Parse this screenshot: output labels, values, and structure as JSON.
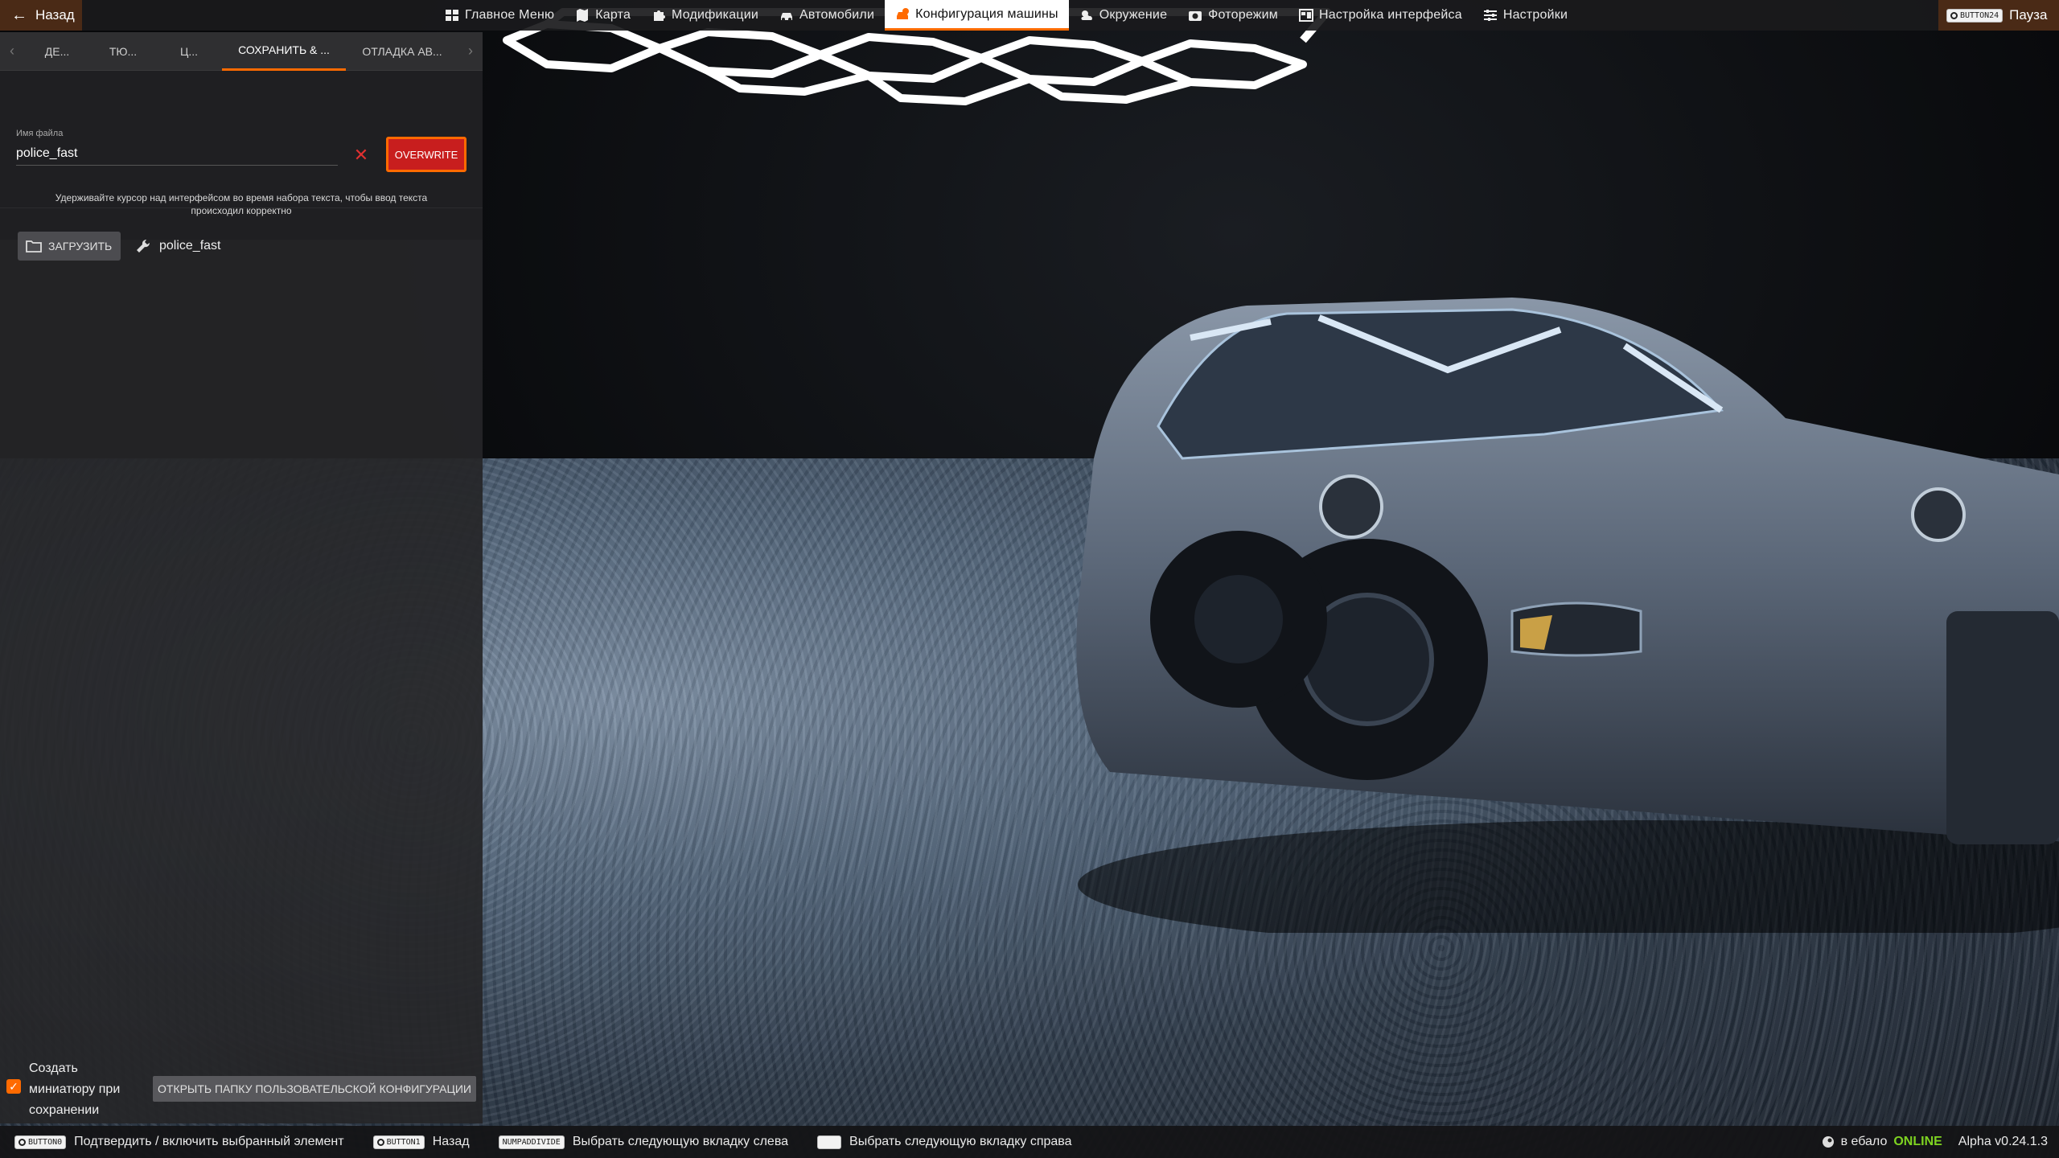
{
  "topbar": {
    "back_label": "Назад",
    "pause_key": "BUTTON24",
    "pause_label": "Пауза",
    "menu": [
      {
        "label": "Главное Меню",
        "icon": "main-menu-icon"
      },
      {
        "label": "Карта",
        "icon": "map-icon"
      },
      {
        "label": "Модификации",
        "icon": "puzzle-icon"
      },
      {
        "label": "Автомобили",
        "icon": "car-icon"
      },
      {
        "label": "Конфигурация машины",
        "icon": "car-config-icon",
        "active": true
      },
      {
        "label": "Окружение",
        "icon": "weather-icon"
      },
      {
        "label": "Фоторежим",
        "icon": "camera-icon"
      },
      {
        "label": "Настройка интерфейса",
        "icon": "ui-layout-icon"
      },
      {
        "label": "Настройки",
        "icon": "sliders-icon"
      }
    ]
  },
  "panel": {
    "tabs": [
      "ДЕ...",
      "ТЮ...",
      "Ц...",
      "СОХРАНИТЬ & ...",
      "ОТЛАДКА АВ..."
    ],
    "active_tab": 3,
    "file": {
      "label": "Имя файла",
      "value": "police_fast",
      "overwrite_label": "OVERWRITE",
      "hint": "Удерживайте курсор над интерфейсом во время набора текста, чтобы ввод текста происходил корректно"
    },
    "load": {
      "button_label": "ЗАГРУЗИТЬ",
      "configs": [
        "police_fast"
      ]
    },
    "bottom": {
      "thumbnail_label": "Создать миниатюру при сохранении",
      "thumbnail_checked": true,
      "open_folder_label": "ОТКРЫТЬ ПАПКУ ПОЛЬЗОВАТЕЛЬСКОЙ КОНФИГУРАЦИИ"
    }
  },
  "statusbar": {
    "hints": [
      {
        "key": "BUTTON0",
        "label": "Подтвердить / включить выбранный элемент"
      },
      {
        "key": "BUTTON1",
        "label": "Назад"
      },
      {
        "key": "NUMPADDIVIDE",
        "label": "Выбрать следующую вкладку слева"
      },
      {
        "key": "",
        "label": "Выбрать следующую вкладку справа"
      }
    ],
    "online_prefix": "в ебало",
    "online_status": "ONLINE",
    "version": "Alpha v0.24.1.3"
  },
  "colors": {
    "accent": "#ff6a00",
    "overwrite": "#c81e1e",
    "online": "#7ed321"
  }
}
